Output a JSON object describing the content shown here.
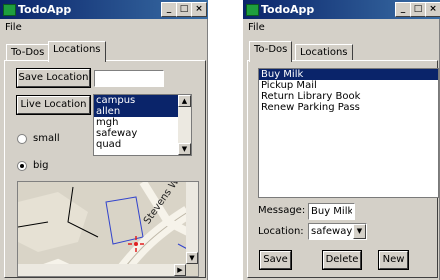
{
  "app_title": "TodoApp",
  "menu": {
    "file": "File"
  },
  "tabs": {
    "todos": "To-Dos",
    "locations": "Locations"
  },
  "window_buttons": {
    "minimize": "_",
    "maximize": "□",
    "close": "×"
  },
  "locations_tab": {
    "save_location_label": "Save Location",
    "save_location_value": "",
    "live_location_label": "Live Location",
    "locations": [
      "campus",
      "allen",
      "mgh",
      "safeway",
      "quad"
    ],
    "selected_locations": [
      "campus",
      "allen"
    ],
    "size_small_label": "small",
    "size_big_label": "big",
    "selected_size": "big",
    "map_street_label": "Stevens Way"
  },
  "todos_tab": {
    "items": [
      "Buy Milk",
      "Pickup Mail",
      "Return Library Book",
      "Renew Parking Pass"
    ],
    "selected_item": "Buy Milk",
    "message_label": "Message:",
    "message_value": "Buy Milk",
    "location_label": "Location:",
    "location_value": "safeway",
    "save_label": "Save",
    "delete_label": "Delete",
    "new_label": "New"
  },
  "colors": {
    "titlebar": "#0a246a",
    "selection": "#0a246a",
    "face": "#d4d0c8"
  }
}
